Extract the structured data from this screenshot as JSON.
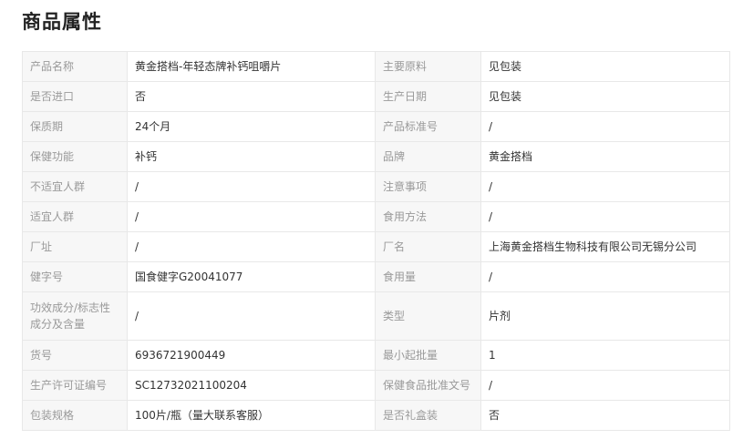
{
  "title": "商品属性",
  "rows": [
    {
      "l1": "产品名称",
      "v1": "黄金搭档-年轻态牌补钙咀嚼片",
      "l2": "主要原料",
      "v2": "见包装"
    },
    {
      "l1": "是否进口",
      "v1": "否",
      "l2": "生产日期",
      "v2": "见包装"
    },
    {
      "l1": "保质期",
      "v1": "24个月",
      "l2": "产品标准号",
      "v2": "/"
    },
    {
      "l1": "保健功能",
      "v1": "补钙",
      "l2": "品牌",
      "v2": "黄金搭档"
    },
    {
      "l1": "不适宜人群",
      "v1": "/",
      "l2": "注意事项",
      "v2": "/"
    },
    {
      "l1": "适宜人群",
      "v1": "/",
      "l2": "食用方法",
      "v2": "/"
    },
    {
      "l1": "厂址",
      "v1": "/",
      "l2": "厂名",
      "v2": "上海黄金搭档生物科技有限公司无锡分公司"
    },
    {
      "l1": "健字号",
      "v1": "国食健字G20041077",
      "l2": "食用量",
      "v2": "/"
    },
    {
      "l1": "功效成分/标志性成分及含量",
      "v1": "/",
      "l2": "类型",
      "v2": "片剂"
    },
    {
      "l1": "货号",
      "v1": "6936721900449",
      "l2": "最小起批量",
      "v2": "1"
    },
    {
      "l1": "生产许可证编号",
      "v1": "SC12732021100204",
      "l2": "保健食品批准文号",
      "v2": "/"
    },
    {
      "l1": "包装规格",
      "v1": "100片/瓶（量大联系客服）",
      "l2": "是否礼盒装",
      "v2": "否"
    }
  ]
}
